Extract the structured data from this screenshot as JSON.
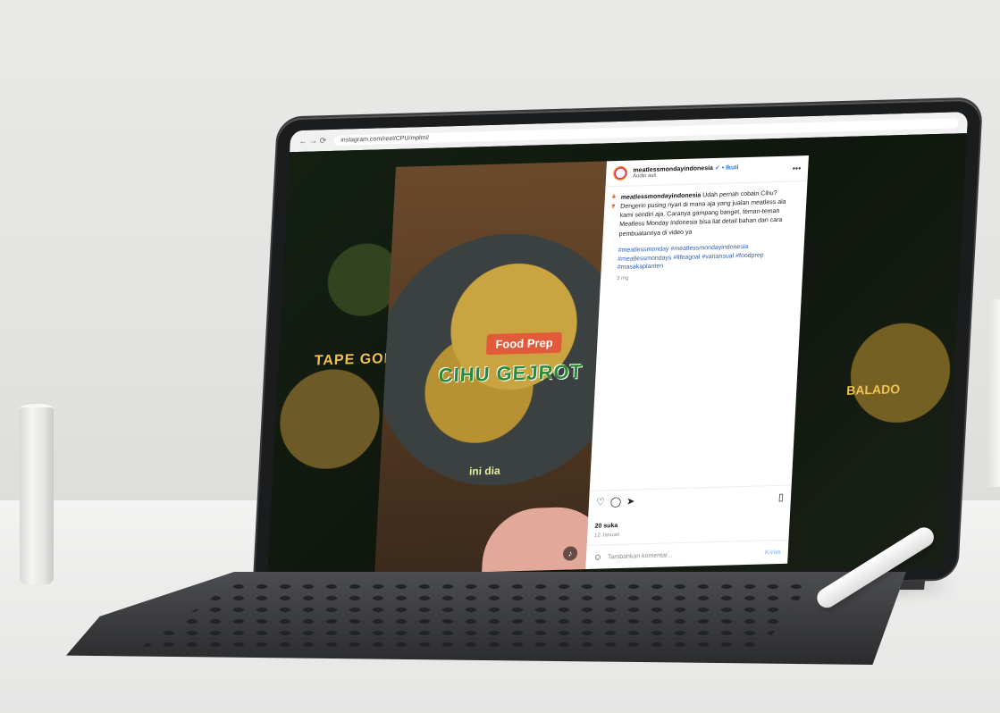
{
  "browser": {
    "nav_icons": "← → ⟳",
    "url": "instagram.com/reel/CPU/mplmi/"
  },
  "post": {
    "account": "meatlessmondayindonesia",
    "follow_label": "• Ikuti",
    "subtitle": "Audio asli",
    "more": "•••",
    "caption_handle": "meatlessmondayindonesia",
    "caption": "Udah pernah cobain Cihu? Dengerin pusing nyari di mana aja yang jualan meatless ala kami sendiri aja. Caranya gampang banget, teman-teman Meatless Monday Indonesia bisa liat detail bahan dan cara pembuatannya di video ya",
    "hashtags": "#meatlessmonday #meatlessmondayindonesia #meatlessmondays #lifeagoal #variansual #foodprep #masakaplanten",
    "age": "3 mg",
    "likes": "20 suka",
    "date": "12 Januari",
    "comment_placeholder": "Tambahkan komentar...",
    "post_button": "Kirim"
  },
  "video": {
    "badge": "Food Prep",
    "title": "CIHU GEJROT",
    "caption": "ini dia"
  },
  "background": {
    "left_label": "TAPE GORENG",
    "right_label": "BALADO"
  },
  "icons": {
    "heart": "♡",
    "comment": "◯",
    "share": "➤",
    "bookmark": "🔖",
    "emoji": "☺",
    "sound": "♪"
  }
}
